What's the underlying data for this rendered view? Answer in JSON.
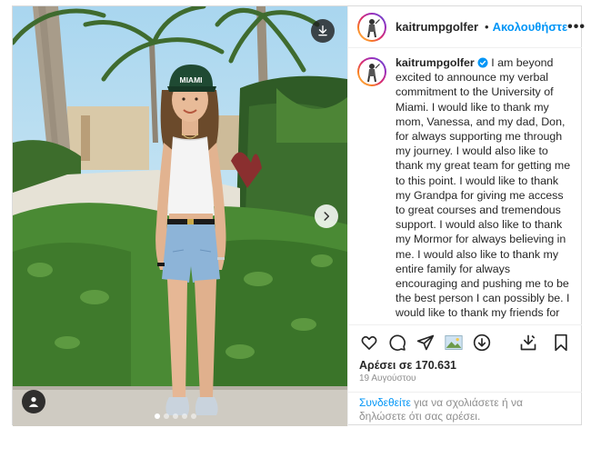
{
  "post": {
    "username": "kaitrumpgolfer",
    "follow_label": "Ακολουθήστε",
    "separator": "•",
    "more_label": "•••",
    "caption": "I am beyond excited to announce my verbal commitment to the University of Miami. I would like to thank my mom, Vanessa, and my dad, Don, for always supporting me through my journey. I would also like to thank my great team for getting me to this point. I would like to thank my Grandpa for giving me access to great courses and tremendous support. I would also like to thank my Mormor for always believing in me. I would also like to thank my entire family for always encouraging and pushing me to be the best person I can possibly be. I would like to thank my friends for always cheering me on. Last but not least I would love to thank Coach Janice and Coach Jim for giving me this opportunity. I am super excited",
    "likes": "Αρέσει σε 170.631",
    "date": "19 Αυγούστου",
    "login_link": "Συνδεθείτε",
    "login_text": " για να σχολιάσετε ή να δηλώσετε ότι σας αρέσει."
  },
  "photo": {
    "cap_text": "MIAMI"
  },
  "icons": [
    "download-icon",
    "chevron-right-icon",
    "user-tag-icon",
    "heart-icon",
    "comment-icon",
    "share-icon",
    "image-thumb-icon",
    "download-icon",
    "save-download-icon",
    "bookmark-icon",
    "more-icon",
    "verified-icon"
  ],
  "colors": {
    "link": "#0095f6",
    "verified": "#0095f6",
    "text": "#262626",
    "muted": "#8e8e8e"
  }
}
